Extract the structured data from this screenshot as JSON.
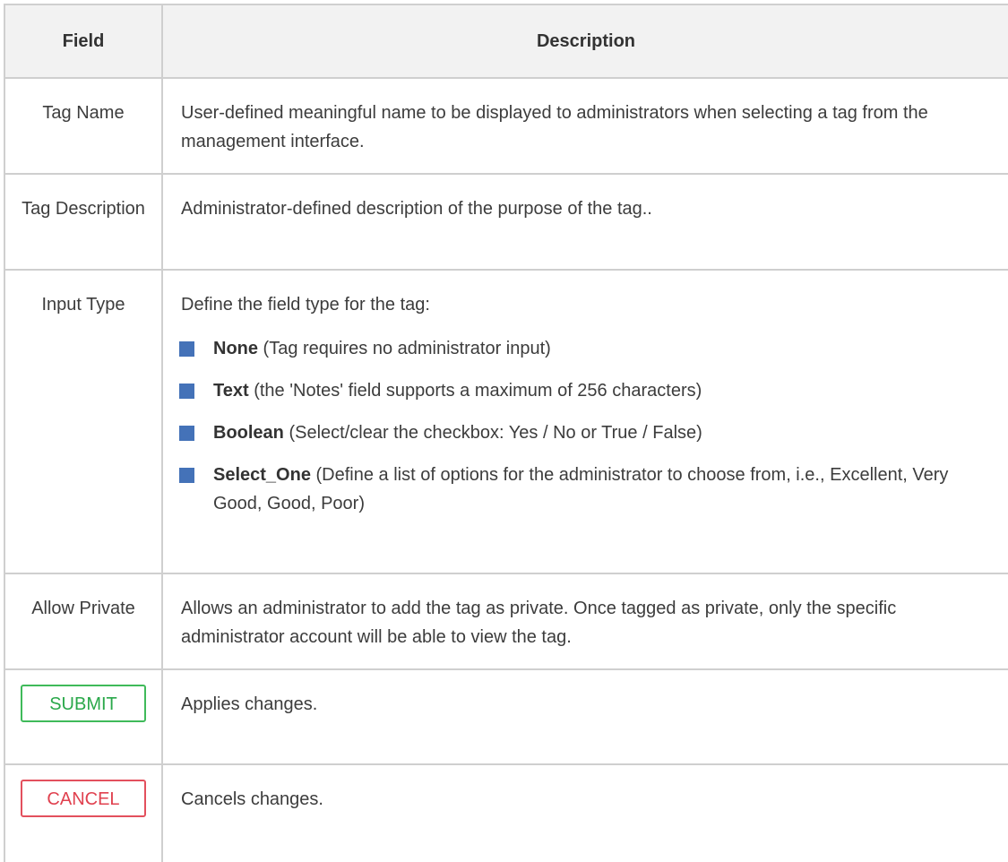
{
  "table": {
    "headers": {
      "field": "Field",
      "description": "Description"
    },
    "rows": {
      "tag_name": {
        "field": "Tag Name",
        "description": "User-defined meaningful name to be displayed to administrators when selecting a tag from the management interface."
      },
      "tag_description": {
        "field": "Tag Description",
        "description": "Administrator-defined description of the purpose of the tag.."
      },
      "input_type": {
        "field": "Input Type",
        "intro": "Define the field type for the tag:",
        "options": [
          {
            "term": "None",
            "detail": " (Tag requires no administrator input)"
          },
          {
            "term": "Text",
            "detail": " (the 'Notes' field supports a maximum of 256 characters)"
          },
          {
            "term": "Boolean",
            "detail": " (Select/clear the checkbox: Yes / No or True / False)"
          },
          {
            "term": "Select_One",
            "detail": " (Define a list of options for the administrator to choose from, i.e., Excellent, Very Good, Good, Poor)"
          }
        ]
      },
      "allow_private": {
        "field": "Allow Private",
        "description": "Allows an administrator to add the tag as private. Once tagged as private, only the specific administrator account will be able to view the tag."
      },
      "submit": {
        "button_label": "SUBMIT",
        "description": "Applies changes."
      },
      "cancel": {
        "button_label": "CANCEL",
        "description": "Cancels changes."
      }
    }
  },
  "colors": {
    "header_background": "#f2f2f2",
    "border": "#cfcfcf",
    "bullet": "#4472b8",
    "submit_green": "#2aa84a",
    "cancel_red": "#e0414f"
  },
  "icons": {
    "bullet": "square-bullet-icon"
  }
}
